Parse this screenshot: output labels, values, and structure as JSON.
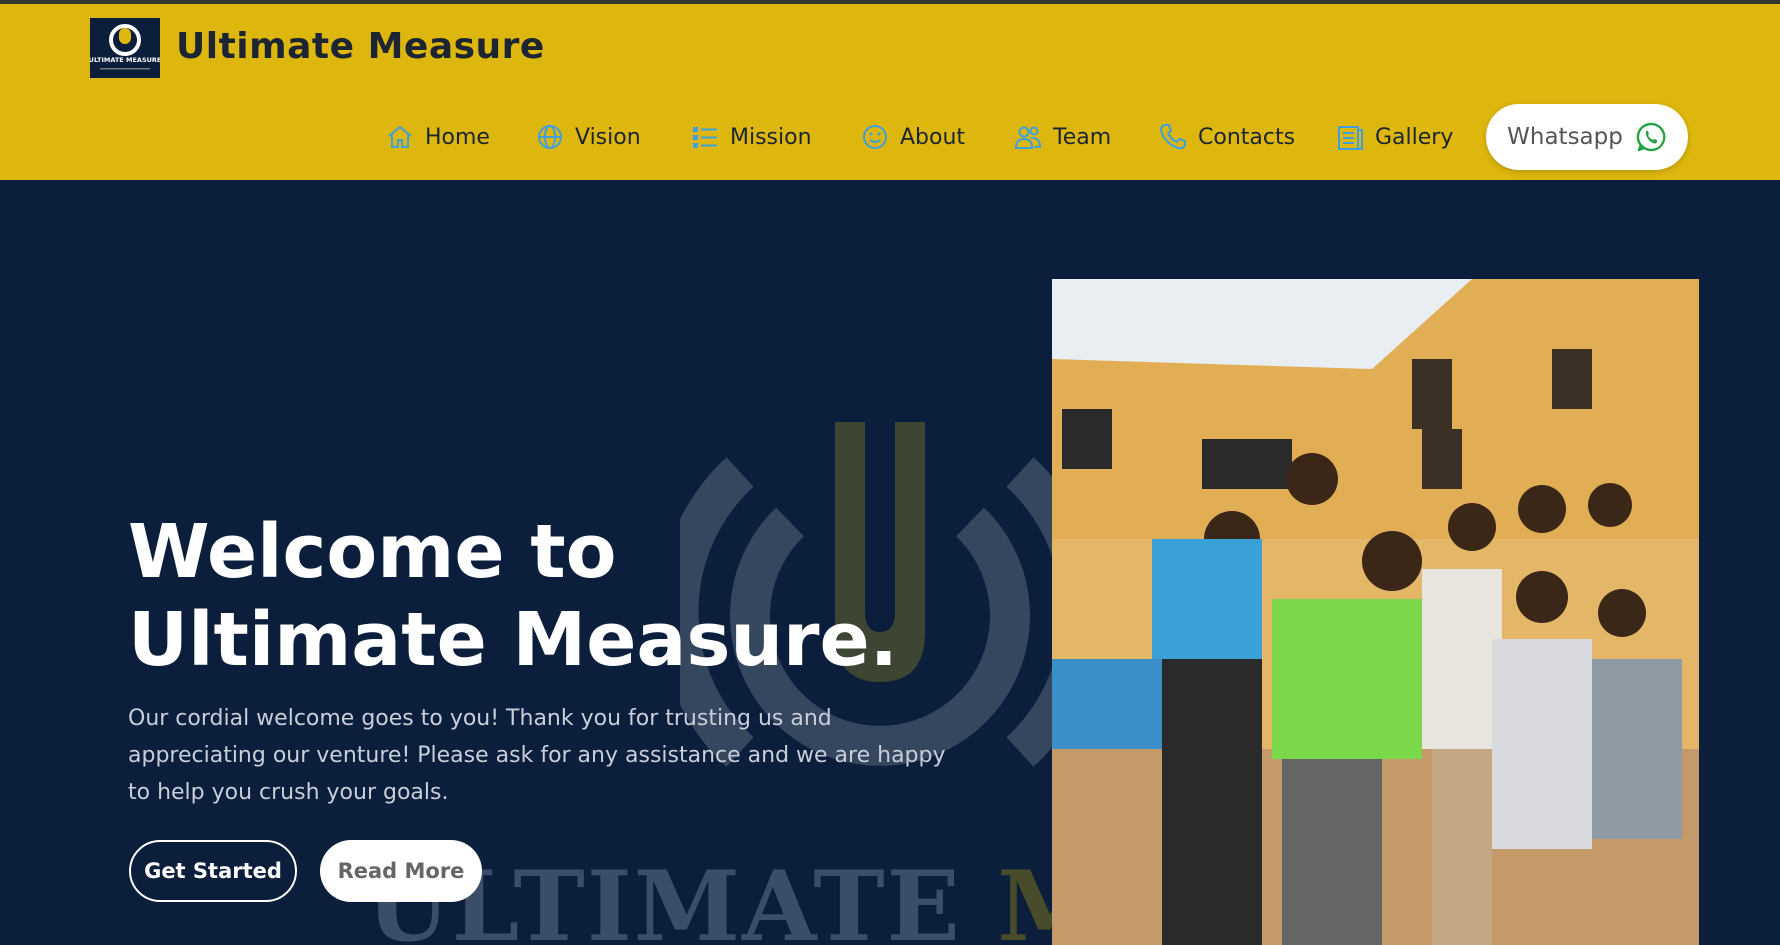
{
  "brand": {
    "name": "Ultimate Measure",
    "logo_text": "ULTIMATE MEASURE"
  },
  "nav": {
    "items": [
      {
        "label": "Home",
        "icon": "home-icon"
      },
      {
        "label": "Vision",
        "icon": "globe-icon"
      },
      {
        "label": "Mission",
        "icon": "list-icon"
      },
      {
        "label": "About",
        "icon": "smile-icon"
      },
      {
        "label": "Team",
        "icon": "people-icon"
      },
      {
        "label": "Contacts",
        "icon": "phone-icon"
      },
      {
        "label": "Gallery",
        "icon": "gallery-icon"
      }
    ],
    "whatsapp_label": "Whatsapp"
  },
  "hero": {
    "title": "Welcome to Ultimate Measure.",
    "text": "Our cordial welcome goes to you! Thank you for trusting us and appreciating our venture! Please ask for any assistance and we are happy to help you crush your goals.",
    "primary_button": "Get Started",
    "secondary_button": "Read More",
    "watermark_part1": "ULTIMATE",
    "watermark_part2": "ME"
  },
  "colors": {
    "header_bg": "#ddb70e",
    "hero_bg": "#0b1f3d",
    "icon_blue": "#3fa0e0",
    "whatsapp_green": "#25a244"
  }
}
